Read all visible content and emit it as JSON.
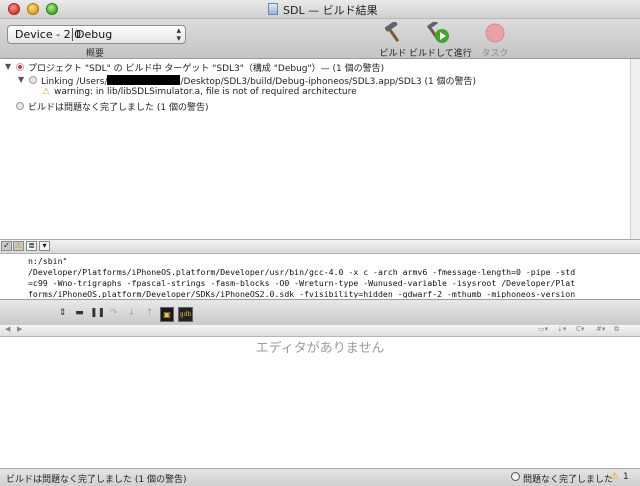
{
  "window": {
    "title": "SDL — ビルド結果"
  },
  "toolbar": {
    "device_popup": "Device - 2.0",
    "config_popup": "Debug",
    "overview_label": "概要",
    "build_label": "ビルド",
    "build_and_run_label": "ビルドして進行",
    "tasks_label": "タスク"
  },
  "results": {
    "project_line": "プロジェクト \"SDL\" の ビルド中 ターゲット \"SDL3\"（構成 \"Debug\"）— (1 個の警告)",
    "linking_prefix": "Linking /Users/",
    "linking_suffix": "/Desktop/SDL3/build/Debug-iphoneos/SDL3.app/SDL3 (1 個の警告)",
    "warning_line": "warning: in lib/libSDLSimulator.a, file is not of required architecture",
    "summary_line": "ビルドは問題なく完了しました (1 個の警告)"
  },
  "transcript": {
    "lines": [
      "n:/sbin\"",
      "/Developer/Platforms/iPhoneOS.platform/Developer/usr/bin/gcc-4.0 -x c -arch armv6 -fmessage-length=0 -pipe -std",
      "=c99 -Wno-trigraphs -fpascal-strings -fasm-blocks -O0 -Wreturn-type -Wunused-variable -isysroot /Developer/Plat",
      "forms/iPhoneOS.platform/Developer/SDKs/iPhoneOS2.0.sdk -fvisibility=hidden -gdwarf-2 -mthumb -miphoneos-version"
    ]
  },
  "editor": {
    "empty_message": "エディタがありません"
  },
  "statusbar": {
    "left": "ビルドは問題なく完了しました (1 個の警告)",
    "right": "問題なく完了しました",
    "warning_count": "1"
  }
}
